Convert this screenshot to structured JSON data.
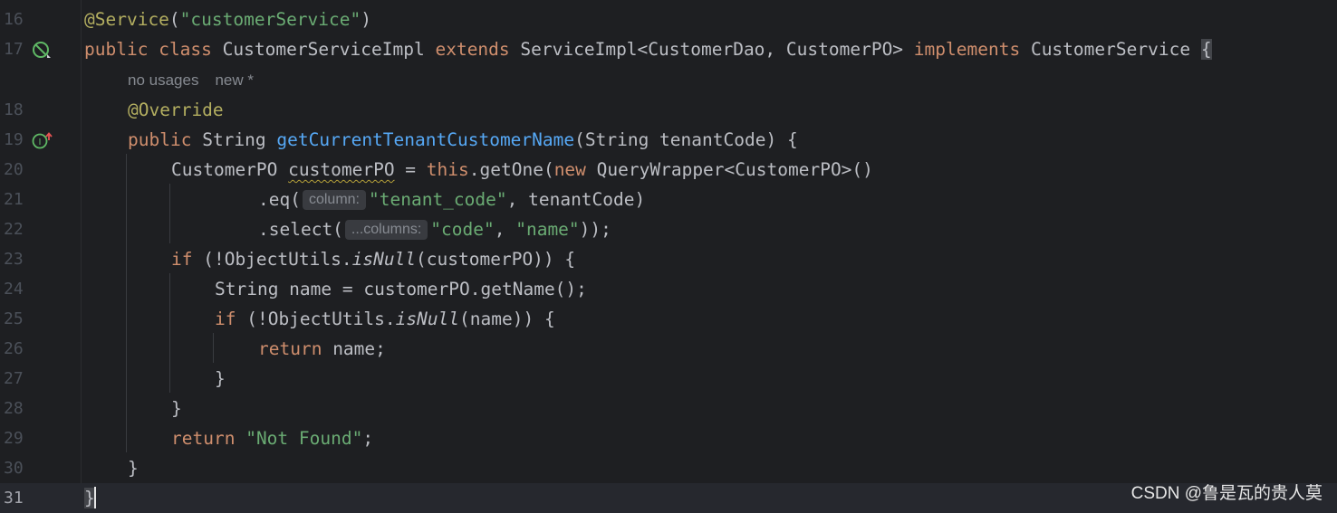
{
  "editor": {
    "line_numbers": [
      "16",
      "17",
      "18",
      "19",
      "20",
      "21",
      "22",
      "23",
      "24",
      "25",
      "26",
      "27",
      "28",
      "29",
      "30",
      "31"
    ],
    "code_lens": {
      "usages": "no usages",
      "status": "new *"
    },
    "gutter_icons": {
      "line17": "no-entry-implement-icon",
      "line19": "implements-method-icon"
    },
    "lines": {
      "l16": {
        "ann": "@Service",
        "open": "(",
        "str": "\"customerService\"",
        "close": ")"
      },
      "l17": {
        "kw1": "public",
        "kw2": "class",
        "name": "CustomerServiceImpl",
        "kw3": "extends",
        "parent": "ServiceImpl<CustomerDao, CustomerPO>",
        "kw4": "implements",
        "iface": "CustomerService",
        "brace": "{"
      },
      "l18": {
        "ann": "@Override"
      },
      "l19": {
        "kw": "public",
        "type": "String",
        "method": "getCurrentTenantCustomerName",
        "params": "(String tenantCode) {"
      },
      "l20": {
        "type": "CustomerPO",
        "var": "customerPO",
        "assign": " = ",
        "kw_this": "this",
        "call": ".getOne(",
        "kw_new": "new",
        "rest": " QueryWrapper<CustomerPO>()"
      },
      "l21": {
        "call": ".eq(",
        "hint": "column:",
        "str": "\"tenant_code\"",
        "rest": ", tenantCode)"
      },
      "l22": {
        "call": ".select(",
        "hint": "...columns:",
        "str1": "\"code\"",
        "sep": ", ",
        "str2": "\"name\"",
        "rest": "));"
      },
      "l23": {
        "kw": "if",
        "pre": " (!ObjectUtils.",
        "fn": "isNull",
        "rest": "(customerPO)) {"
      },
      "l24": {
        "text": "String name = customerPO.getName();"
      },
      "l25": {
        "kw": "if",
        "pre": " (!ObjectUtils.",
        "fn": "isNull",
        "rest": "(name)) {"
      },
      "l26": {
        "kw": "return",
        "rest": " name;"
      },
      "l27": {
        "text": "}"
      },
      "l28": {
        "text": "}"
      },
      "l29": {
        "kw": "return",
        "str": "\"Not Found\"",
        "rest": ";"
      },
      "l30": {
        "text": "}"
      },
      "l31": {
        "text": "}"
      }
    }
  },
  "watermark": "CSDN @鲁是瓦的贵人莫",
  "colors": {
    "background": "#1e1f22",
    "keyword": "#cf8e6d",
    "string": "#6aab73",
    "annotation": "#b3ae60",
    "method_declaration": "#56a8f5",
    "default_text": "#bcbec4",
    "line_number": "#4b5059"
  }
}
